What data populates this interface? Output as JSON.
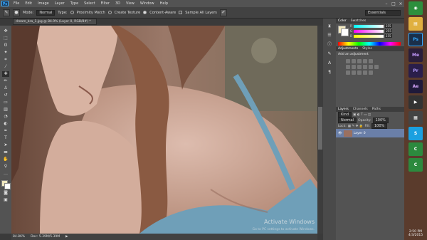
{
  "app": {
    "logo": "Ps"
  },
  "menu": [
    "File",
    "Edit",
    "Image",
    "Layer",
    "Type",
    "Select",
    "Filter",
    "3D",
    "View",
    "Window",
    "Help"
  ],
  "window_controls": [
    "–",
    "□",
    "×"
  ],
  "options": {
    "mode_label": "Mode:",
    "mode_value": "Normal",
    "type_label": "Type:",
    "proximity": "Proximity Match",
    "texture": "Create Texture",
    "content_aware": "Content-Aware",
    "sample_all": "Sample All Layers",
    "workspace": "Essentials"
  },
  "doc_tab": "dream_bra_1.jpg @ 84.9% (Layer 0, RGB/8#) *",
  "status": {
    "zoom": "84.86%",
    "doc": "Doc: 5.39M/5.39M"
  },
  "watermark": {
    "title": "Activate Windows",
    "sub": "Go to PC settings to activate Windows."
  },
  "panels": {
    "color_tabs": [
      "Color",
      "Swatches"
    ],
    "rgb": [
      {
        "label": "R",
        "value": "255"
      },
      {
        "label": "G",
        "value": "255"
      },
      {
        "label": "B",
        "value": "255"
      }
    ],
    "adj_tabs": [
      "Adjustments",
      "Styles"
    ],
    "adj_title": "Add an adjustment",
    "layer_tabs": [
      "Layers",
      "Channels",
      "Paths"
    ],
    "kind": "Kind",
    "blend": "Normal",
    "opacity_label": "Opacity:",
    "opacity_value": "100%",
    "lock_label": "Lock:",
    "fill_label": "Fill:",
    "fill_value": "100%",
    "layer_name": "Layer 0"
  },
  "taskbar": {
    "apps": [
      {
        "name": "Chrome",
        "label": "◉",
        "color": "#2d8f3d"
      },
      {
        "name": "Explorer",
        "label": "▤",
        "color": "#e0b040"
      },
      {
        "name": "Photoshop",
        "label": "Ps",
        "color": "#1a2f4a"
      },
      {
        "name": "Media Encoder",
        "label": "Me",
        "color": "#2a1e3a"
      },
      {
        "name": "Premiere",
        "label": "Pr",
        "color": "#2a1e4a"
      },
      {
        "name": "After Effects",
        "label": "Ae",
        "color": "#1f1a3a"
      },
      {
        "name": "App",
        "label": "▶",
        "color": "#333"
      },
      {
        "name": "App2",
        "label": "▦",
        "color": "#444"
      },
      {
        "name": "Skype",
        "label": "S",
        "color": "#1aa0e0"
      },
      {
        "name": "Camtasia",
        "label": "C",
        "color": "#2c8a3e"
      },
      {
        "name": "Camtasia Rec",
        "label": "C",
        "color": "#2c8a3e"
      }
    ],
    "clock_time": "2:50 PM",
    "clock_date": "4/3/2015"
  },
  "colors": {
    "accent": "#31a8ff",
    "panel": "#535353",
    "canvas_skin": "#c9a592"
  }
}
